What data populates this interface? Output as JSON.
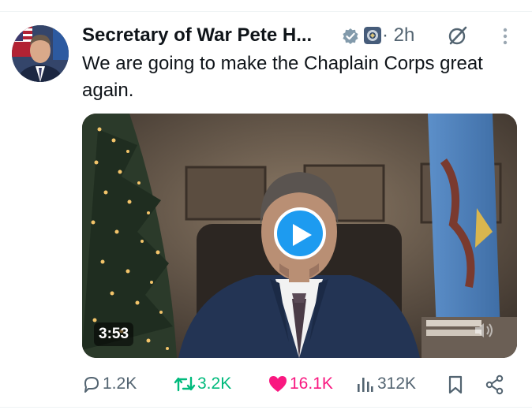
{
  "author": {
    "display_name": "Secretary of War Pete H...",
    "verified": true,
    "affiliation_badge": "department-seal",
    "time_ago": "· 2h"
  },
  "tweet": {
    "text": "We are going to make the Chaplain Corps great again."
  },
  "media": {
    "type": "video",
    "duration": "3:53"
  },
  "actions": {
    "replies": "1.2K",
    "reposts": "3.2K",
    "likes": "16.1K",
    "liked": true,
    "views": "312K"
  },
  "colors": {
    "accent": "#1d9bf0",
    "repost_green": "#00ba7c",
    "like_pink": "#f91880",
    "secondary_text": "#536471"
  }
}
